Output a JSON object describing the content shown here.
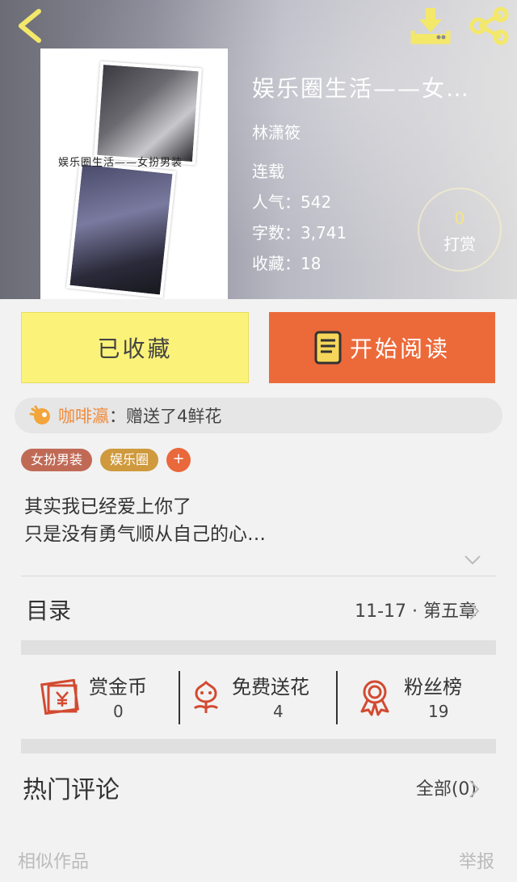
{
  "header": {
    "back_icon": "chevron-left-icon",
    "download_icon": "download-icon",
    "share_icon": "share-icon",
    "icon_color": "#f3e86a"
  },
  "book": {
    "title": "娱乐圈生活——女…",
    "cover_caption": "娱乐圈生活——女扮男装",
    "author": "林潇筱",
    "status": "连载",
    "popularity": "人气：542",
    "word_count": "字数：3,741",
    "favorites": "收藏：18"
  },
  "tip": {
    "count": "0",
    "label": "打赏"
  },
  "actions": {
    "favorited_label": "已收藏",
    "read_label": "开始阅读",
    "fav_color": "#fbf27a",
    "read_color": "#ec6a3a"
  },
  "gift_notice": {
    "user": "咖啡瀛",
    "message": "：赠送了4鲜花"
  },
  "tags": [
    "女扮男装",
    "娱乐圈"
  ],
  "tag_add": "+",
  "description": {
    "line1": "其实我已经爱上你了",
    "line2": "只是没有勇气顺从自己的心…"
  },
  "toc": {
    "label": "目录",
    "latest": "11-17 · 第五章"
  },
  "stats": [
    {
      "label": "赏金币",
      "value": "0",
      "icon": "red-envelope-icon"
    },
    {
      "label": "免费送花",
      "value": "4",
      "icon": "flower-icon"
    },
    {
      "label": "粉丝榜",
      "value": "19",
      "icon": "rank-medal-icon"
    }
  ],
  "comments": {
    "label": "热门评论",
    "all": "全部(0)"
  },
  "footer": {
    "similar": "相似作品",
    "report": "举报"
  }
}
